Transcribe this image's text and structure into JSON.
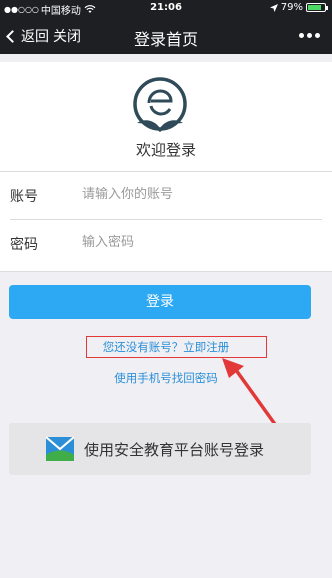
{
  "status_bar": {
    "carrier": "中国移动",
    "signal": "●●○○○",
    "time": "21:06",
    "battery": "79%",
    "battery_level": 0.79
  },
  "nav": {
    "back_label": "返回",
    "close_label": "关闭",
    "title": "登录首页"
  },
  "welcome_text": "欢迎登录",
  "form": {
    "account_label": "账号",
    "account_placeholder": "请输入你的账号",
    "password_label": "密码",
    "password_placeholder": "输入密码"
  },
  "login_button": "登录",
  "register_link": "您还没有账号？立即注册",
  "recover_link": "使用手机号找回密码",
  "platform_login": "使用安全教育平台账号登录",
  "colors": {
    "accent": "#2da8f2",
    "link": "#2a8fd8",
    "highlight": "#e23838",
    "bar": "#1e1f23"
  }
}
